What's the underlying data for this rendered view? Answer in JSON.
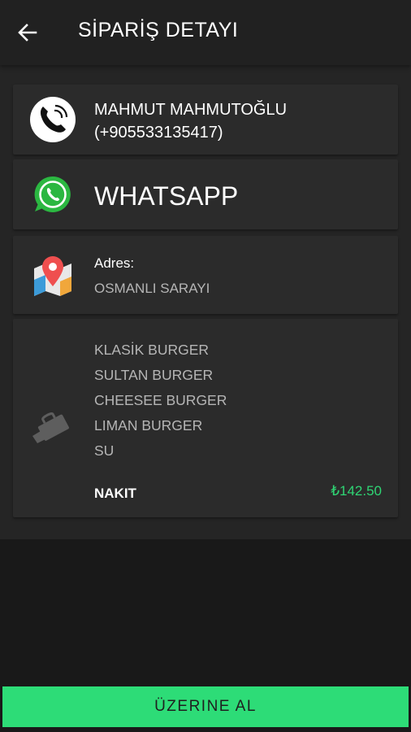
{
  "header": {
    "title": "SİPARİŞ DETAYI",
    "back_icon": "arrow-left-icon"
  },
  "contact": {
    "name": "MAHMUT MAHMUTOĞLU",
    "phone": "(+905533135417)",
    "icon": "phone-icon"
  },
  "whatsapp": {
    "label": "WHATSAPP",
    "icon": "whatsapp-icon"
  },
  "address": {
    "label": "Adres:",
    "value": "OSMANLI SARAYI",
    "icon": "map-pin-icon"
  },
  "order": {
    "icon": "shopping-bag-icon",
    "items": [
      "KLASİK BURGER",
      "SULTAN BURGER",
      "CHEESEE BURGER",
      "LIMAN BURGER",
      "SU"
    ],
    "payment_method": "NAKIT",
    "total": "₺142.50"
  },
  "action": {
    "label": "ÜZERINE AL"
  },
  "colors": {
    "accent": "#2ddc77",
    "price": "#2fd574",
    "whatsapp_green": "#2bb741"
  }
}
